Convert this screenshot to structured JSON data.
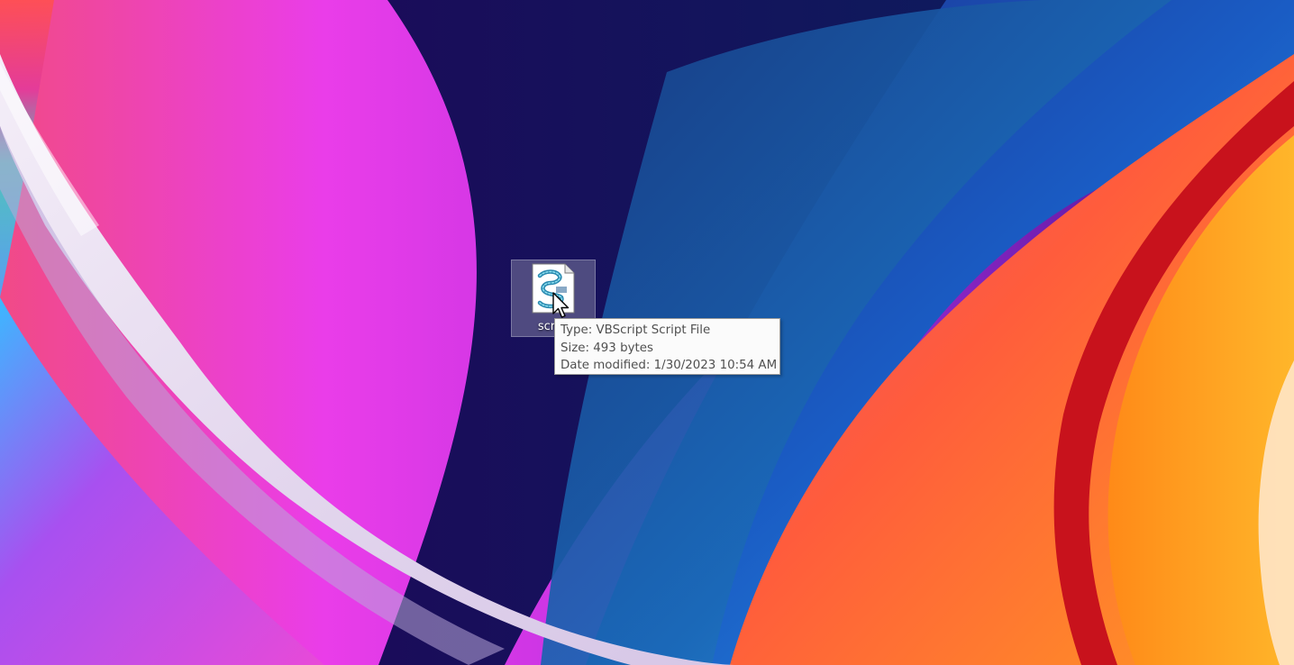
{
  "desktop": {
    "wallpaper": "abstract-curved-gradient-wallpaper",
    "colors": {
      "magenta": "#e43ce8",
      "violet": "#7a2fd6",
      "navy": "#0c1a52",
      "blue": "#1f6fd0",
      "orange": "#ff7a2a",
      "red": "#d21818",
      "white_ribbon": "#e8dff0"
    },
    "icons": [
      {
        "label": "script",
        "icon": "vbscript-file-icon",
        "selected": true
      }
    ]
  },
  "tooltip": {
    "type_line": "Type: VBScript Script File",
    "size_line": "Size: 493 bytes",
    "date_line": "Date modified: 1/30/2023 10:54 AM"
  },
  "cursor": {
    "icon": "arrow-cursor-icon"
  }
}
